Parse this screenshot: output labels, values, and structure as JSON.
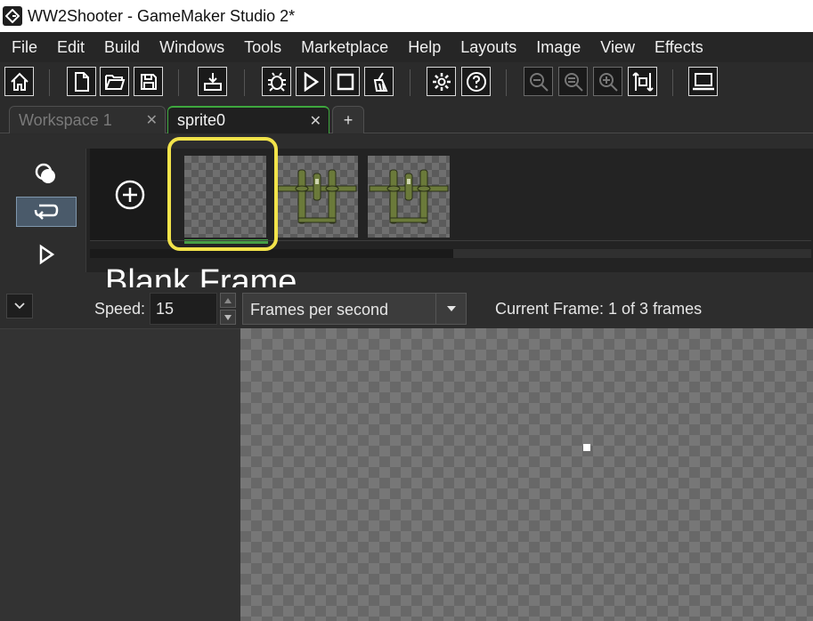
{
  "window": {
    "title": "WW2Shooter - GameMaker Studio 2*"
  },
  "menu": {
    "items": [
      "File",
      "Edit",
      "Build",
      "Windows",
      "Tools",
      "Marketplace",
      "Help",
      "Layouts",
      "Image",
      "View",
      "Effects"
    ]
  },
  "toolbar": {
    "buttons": [
      {
        "name": "home",
        "icon": "home-icon"
      },
      {
        "name": "new-project",
        "icon": "new-file-icon"
      },
      {
        "name": "open-project",
        "icon": "open-folder-icon"
      },
      {
        "name": "save-project",
        "icon": "save-icon"
      },
      {
        "name": "create-executable",
        "icon": "download-tray-icon"
      },
      {
        "name": "debug",
        "icon": "bug-icon"
      },
      {
        "name": "run",
        "icon": "play-icon"
      },
      {
        "name": "stop",
        "icon": "stop-icon"
      },
      {
        "name": "clean",
        "icon": "broom-icon"
      },
      {
        "name": "game-options",
        "icon": "gear-icon"
      },
      {
        "name": "help",
        "icon": "question-icon"
      },
      {
        "name": "zoom-out",
        "icon": "zoom-out-icon"
      },
      {
        "name": "zoom-reset",
        "icon": "zoom-reset-icon"
      },
      {
        "name": "zoom-in",
        "icon": "zoom-in-icon"
      },
      {
        "name": "fit",
        "icon": "fit-icon"
      },
      {
        "name": "target-device",
        "icon": "laptop-icon"
      }
    ]
  },
  "tabs": [
    {
      "label": "Workspace 1",
      "active": false
    },
    {
      "label": "sprite0",
      "active": true
    },
    {
      "label": "+"
    }
  ],
  "sprite_editor": {
    "frame_count": 3,
    "current_frame_index": 1,
    "annotation": "Blank Frame",
    "speed_label": "Speed:",
    "speed_value": "15",
    "speed_unit": "Frames per second",
    "current_frame_text": "Current Frame: 1 of 3 frames"
  },
  "colors": {
    "highlight": "#f2e34a",
    "active_tab": "#3ea83e",
    "frame_marker": "#46a046"
  }
}
